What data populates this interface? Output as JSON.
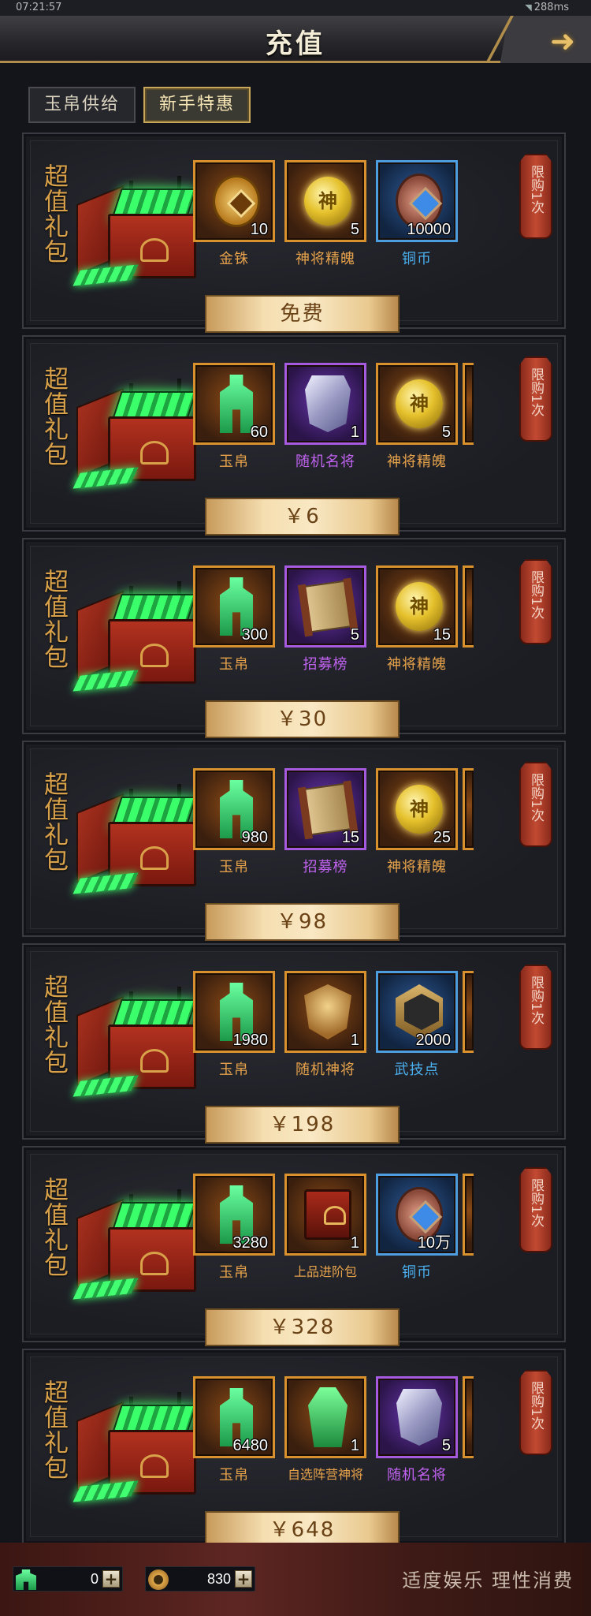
{
  "status_bar": {
    "time": "07:21:57",
    "ping": "288ms"
  },
  "header": {
    "title": "充值"
  },
  "tabs": [
    {
      "label": "玉帛供给",
      "active": false
    },
    {
      "label": "新手特惠",
      "active": true
    }
  ],
  "pack_title": "超值礼包",
  "limit_label": "限购1次",
  "packs": [
    {
      "price": "免费",
      "items": [
        {
          "name": "金铢",
          "count": "10",
          "icon": "gold-coin-icon",
          "rarity": "orange"
        },
        {
          "name": "神将精魄",
          "count": "5",
          "icon": "spirit-orb-icon",
          "rarity": "orange"
        },
        {
          "name": "铜币",
          "count": "10000",
          "icon": "copper-coin-icon",
          "rarity": "blue"
        }
      ]
    },
    {
      "price": "￥6",
      "items": [
        {
          "name": "玉帛",
          "count": "60",
          "icon": "jade-icon",
          "rarity": "orange"
        },
        {
          "name": "随机名将",
          "count": "1",
          "icon": "general-token-icon",
          "rarity": "purple"
        },
        {
          "name": "神将精魄",
          "count": "5",
          "icon": "spirit-orb-icon",
          "rarity": "orange"
        }
      ]
    },
    {
      "price": "￥30",
      "items": [
        {
          "name": "玉帛",
          "count": "300",
          "icon": "jade-icon",
          "rarity": "orange"
        },
        {
          "name": "招募榜",
          "count": "5",
          "icon": "recruit-scroll-icon",
          "rarity": "purple"
        },
        {
          "name": "神将精魄",
          "count": "15",
          "icon": "spirit-orb-icon",
          "rarity": "orange"
        }
      ]
    },
    {
      "price": "￥98",
      "items": [
        {
          "name": "玉帛",
          "count": "980",
          "icon": "jade-icon",
          "rarity": "orange"
        },
        {
          "name": "招募榜",
          "count": "15",
          "icon": "recruit-scroll-icon",
          "rarity": "purple"
        },
        {
          "name": "神将精魄",
          "count": "25",
          "icon": "spirit-orb-icon",
          "rarity": "orange"
        }
      ]
    },
    {
      "price": "￥198",
      "items": [
        {
          "name": "玉帛",
          "count": "1980",
          "icon": "jade-icon",
          "rarity": "orange"
        },
        {
          "name": "随机神将",
          "count": "1",
          "icon": "divine-general-medal-icon",
          "rarity": "orange"
        },
        {
          "name": "武技点",
          "count": "2000",
          "icon": "skill-point-icon",
          "rarity": "blue"
        }
      ]
    },
    {
      "price": "￥328",
      "items": [
        {
          "name": "玉帛",
          "count": "3280",
          "icon": "jade-icon",
          "rarity": "orange"
        },
        {
          "name": "上品进阶包",
          "count": "1",
          "icon": "advance-chest-icon",
          "rarity": "orange"
        },
        {
          "name": "铜币",
          "count": "10万",
          "icon": "copper-coin-icon",
          "rarity": "blue"
        }
      ]
    },
    {
      "price": "￥648",
      "items": [
        {
          "name": "玉帛",
          "count": "6480",
          "icon": "jade-icon",
          "rarity": "orange"
        },
        {
          "name": "自选阵营神将",
          "count": "1",
          "icon": "faction-general-icon",
          "rarity": "orange"
        },
        {
          "name": "随机名将",
          "count": "5",
          "icon": "general-token-icon",
          "rarity": "purple"
        }
      ]
    }
  ],
  "footer": {
    "jade_amount": "0",
    "coin_amount": "830",
    "slogan": "适度娱乐 理性消费"
  }
}
